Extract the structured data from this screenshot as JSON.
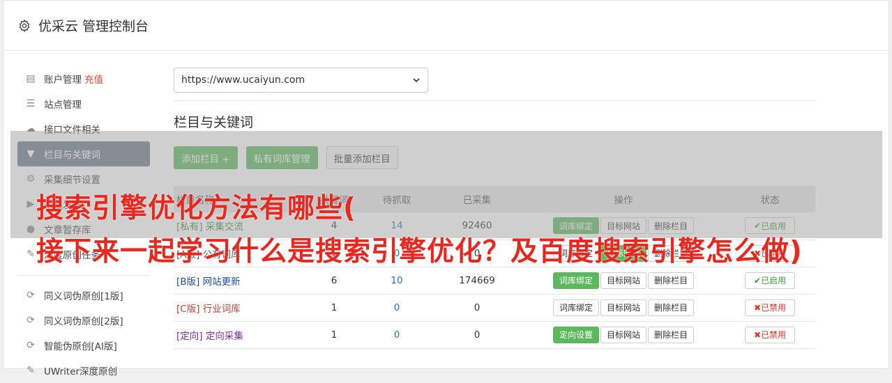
{
  "header": {
    "title": "优采云 管理控制台"
  },
  "sidebar": {
    "items": [
      {
        "label": "账户管理",
        "badge": "充值",
        "icon": "bar-chart-icon"
      },
      {
        "label": "站点管理",
        "icon": "server-icon"
      },
      {
        "label": "接口文件相关",
        "icon": "cloud-upload-icon"
      },
      {
        "label": "栏目与关键词",
        "icon": "filter-icon",
        "active": true
      },
      {
        "label": "采集细节设置",
        "icon": "gears-icon"
      },
      {
        "label": "采集发布",
        "icon": "play-circle-icon"
      },
      {
        "label": "文章暂存库",
        "icon": "database-icon"
      },
      {
        "label": "深度原创任务",
        "icon": "edit-icon"
      }
    ],
    "items2": [
      {
        "label": "同义词伪原创[1版]",
        "icon": "refresh-icon"
      },
      {
        "label": "同义词伪原创[2版]",
        "icon": "refresh-icon"
      },
      {
        "label": "智能伪原创[AI版]",
        "icon": "refresh-icon"
      },
      {
        "label": "UWriter深度原创",
        "icon": "edit-icon"
      }
    ]
  },
  "site_select": {
    "value": "https://www.ucaiyun.com"
  },
  "section": {
    "title": "栏目与关键词"
  },
  "toolbar": {
    "add_column": "添加栏目 +",
    "private_lib": "私有词库管理",
    "batch_add": "批量添加栏目"
  },
  "table": {
    "headers": [
      "栏目名称",
      "关键词",
      "待抓取",
      "已采集",
      "操作",
      "状态"
    ],
    "rows": [
      {
        "tag": "[私有]",
        "name": "采集交流",
        "keywords": "4",
        "pending": "14",
        "collected": "92460",
        "op1": "词库绑定",
        "op2": "目标网站",
        "op3": "删除栏目",
        "status": "已启用"
      },
      {
        "tag": "[A版]",
        "name": "公有词库",
        "keywords": "1",
        "pending": "0",
        "collected": "0",
        "op1": "词库绑定",
        "op2": "目标网站",
        "op3": "删除栏目",
        "status": "已禁用"
      },
      {
        "tag": "[B版]",
        "name": "网站更新",
        "keywords": "6",
        "pending": "10",
        "collected": "174669",
        "op1": "词库绑定",
        "op2": "目标网站",
        "op3": "删除栏目",
        "status": "已启用"
      },
      {
        "tag": "[C版]",
        "name": "行业词库",
        "keywords": "1",
        "pending": "0",
        "collected": "0",
        "op1": "词库绑定",
        "op2": "目标网站",
        "op3": "删除栏目",
        "status": "已禁用"
      },
      {
        "tag": "[定向]",
        "name": "定向采集",
        "keywords": "1",
        "pending": "0",
        "collected": "0",
        "op1": "定向设置",
        "op2": "目标网站",
        "op3": "删除栏目",
        "status": "已禁用"
      }
    ]
  },
  "overlay": {
    "line1": "搜索引擎优化方法有哪些(",
    "line2": "接下来一起学习什么是搜索引擎优化？及百度搜索引擎怎么做)"
  }
}
